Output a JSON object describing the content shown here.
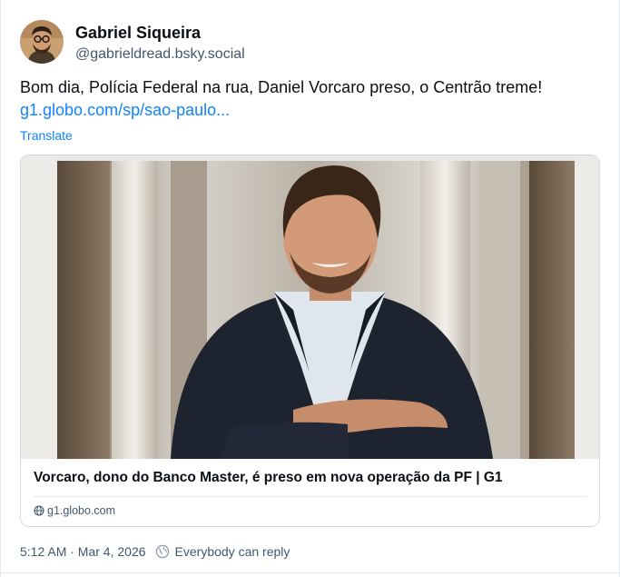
{
  "author": {
    "display_name": "Gabriel Siqueira",
    "handle": "@gabrieldread.bsky.social"
  },
  "post": {
    "text": "Bom dia, Polícia Federal na rua, Daniel Vorcaro preso, o Centrão treme!",
    "link_text": "g1.globo.com/sp/sao-paulo...",
    "translate_label": "Translate"
  },
  "link_card": {
    "title": "Vorcaro, dono do Banco Master, é preso em nova operação da PF | G1",
    "domain": "g1.globo.com",
    "image_icon": "news-photo-man-in-suit"
  },
  "meta": {
    "timestamp": "5:12 AM · Mar 4, 2026",
    "reply_setting": "Everybody can reply"
  },
  "colors": {
    "link": "#1083fe",
    "secondary_text": "#42576c",
    "border": "#d4dbe2"
  }
}
